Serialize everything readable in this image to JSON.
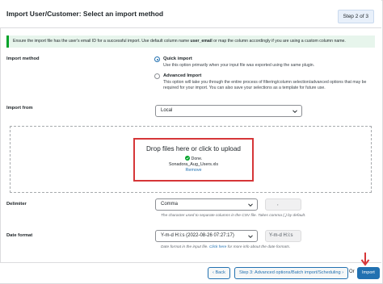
{
  "header": {
    "title": "Import User/Customer: Select an import method",
    "step": "Step 2 of 3"
  },
  "notice": {
    "pre": "Ensure the import file has the user's email ID for a successful import. Use default column name ",
    "bold": "user_email",
    "post": " or map the column accordingly if you are using a custom column name."
  },
  "import_method": {
    "label": "Import method",
    "options": [
      {
        "title": "Quick import",
        "desc": "Use this option primarily when your input file was exported using the same plugin.",
        "checked": true
      },
      {
        "title": "Advanced Import",
        "desc": "This option will take you through the entire process of filtering/column selection/advanced options that may be required for your import. You can also save your selections as a template for future use.",
        "checked": false
      }
    ]
  },
  "import_from": {
    "label": "Import from",
    "value": "Local"
  },
  "upload": {
    "drop_text": "Drop files here or click to upload",
    "status": "Done.",
    "filename": "Sonadora_Aug_Users.xls",
    "remove": "Remove"
  },
  "delimiter": {
    "label": "Delimiter",
    "value": "Comma",
    "custom": ",",
    "help": "The character used to separate columns in the CSV file. Takes comma (,) by default."
  },
  "date_format": {
    "label": "Date format",
    "value": "Y-m-d H:i:s (2022-08-26 07:27:17)",
    "custom": "Y-m-d H:i:s",
    "help_pre": "Date format in the input file. ",
    "help_link": "Click here",
    "help_post": " for more info about the date formats."
  },
  "footer": {
    "back": "Back",
    "next": "Step 3: Advanced options/Batch import/Scheduling",
    "or": "Or",
    "import": "Import"
  },
  "colors": {
    "accent": "#2271b1",
    "success": "#00a32a",
    "highlight": "#d63638"
  }
}
